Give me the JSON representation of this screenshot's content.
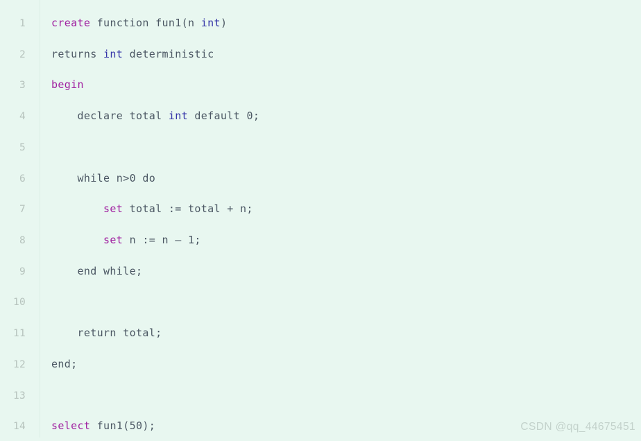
{
  "editor": {
    "background_color": "#e8f7f0",
    "language": "sql",
    "gutter": {
      "number_color": "#b6c3bd",
      "separator_color": "#dcefe6"
    },
    "colors": {
      "keyword": "#a020a0",
      "type": "#3535a8",
      "plain": "#4b5763"
    },
    "lines": [
      {
        "number": "1",
        "text": "create function fun1(n int)",
        "tokens": [
          {
            "t": "create",
            "k": "kw"
          },
          {
            "t": " function fun1(n ",
            "k": "plain"
          },
          {
            "t": "int",
            "k": "type"
          },
          {
            "t": ")",
            "k": "plain"
          }
        ]
      },
      {
        "number": "2",
        "text": "returns int deterministic",
        "tokens": [
          {
            "t": "returns ",
            "k": "plain"
          },
          {
            "t": "int",
            "k": "type"
          },
          {
            "t": " deterministic",
            "k": "plain"
          }
        ]
      },
      {
        "number": "3",
        "text": "begin",
        "tokens": [
          {
            "t": "begin",
            "k": "kw"
          }
        ]
      },
      {
        "number": "4",
        "text": "    declare total int default 0;",
        "tokens": [
          {
            "t": "    declare total ",
            "k": "plain"
          },
          {
            "t": "int",
            "k": "type"
          },
          {
            "t": " default 0;",
            "k": "plain"
          }
        ]
      },
      {
        "number": "5",
        "text": "",
        "tokens": []
      },
      {
        "number": "6",
        "text": "    while n>0 do",
        "tokens": [
          {
            "t": "    while n>0 do",
            "k": "plain"
          }
        ]
      },
      {
        "number": "7",
        "text": "        set total := total + n;",
        "tokens": [
          {
            "t": "        ",
            "k": "plain"
          },
          {
            "t": "set",
            "k": "kw"
          },
          {
            "t": " total := total + n;",
            "k": "plain"
          }
        ]
      },
      {
        "number": "8",
        "text": "        set n := n – 1;",
        "tokens": [
          {
            "t": "        ",
            "k": "plain"
          },
          {
            "t": "set",
            "k": "kw"
          },
          {
            "t": " n := n – 1;",
            "k": "plain"
          }
        ]
      },
      {
        "number": "9",
        "text": "    end while;",
        "tokens": [
          {
            "t": "    end while;",
            "k": "plain"
          }
        ]
      },
      {
        "number": "10",
        "text": "",
        "tokens": []
      },
      {
        "number": "11",
        "text": "    return total;",
        "tokens": [
          {
            "t": "    return total;",
            "k": "plain"
          }
        ]
      },
      {
        "number": "12",
        "text": "end;",
        "tokens": [
          {
            "t": "end;",
            "k": "plain"
          }
        ]
      },
      {
        "number": "13",
        "text": "",
        "tokens": []
      },
      {
        "number": "14",
        "text": "select fun1(50);",
        "tokens": [
          {
            "t": "select",
            "k": "kw"
          },
          {
            "t": " fun1(50);",
            "k": "plain"
          }
        ]
      }
    ]
  },
  "watermark": {
    "text": "CSDN @qq_44675451"
  }
}
